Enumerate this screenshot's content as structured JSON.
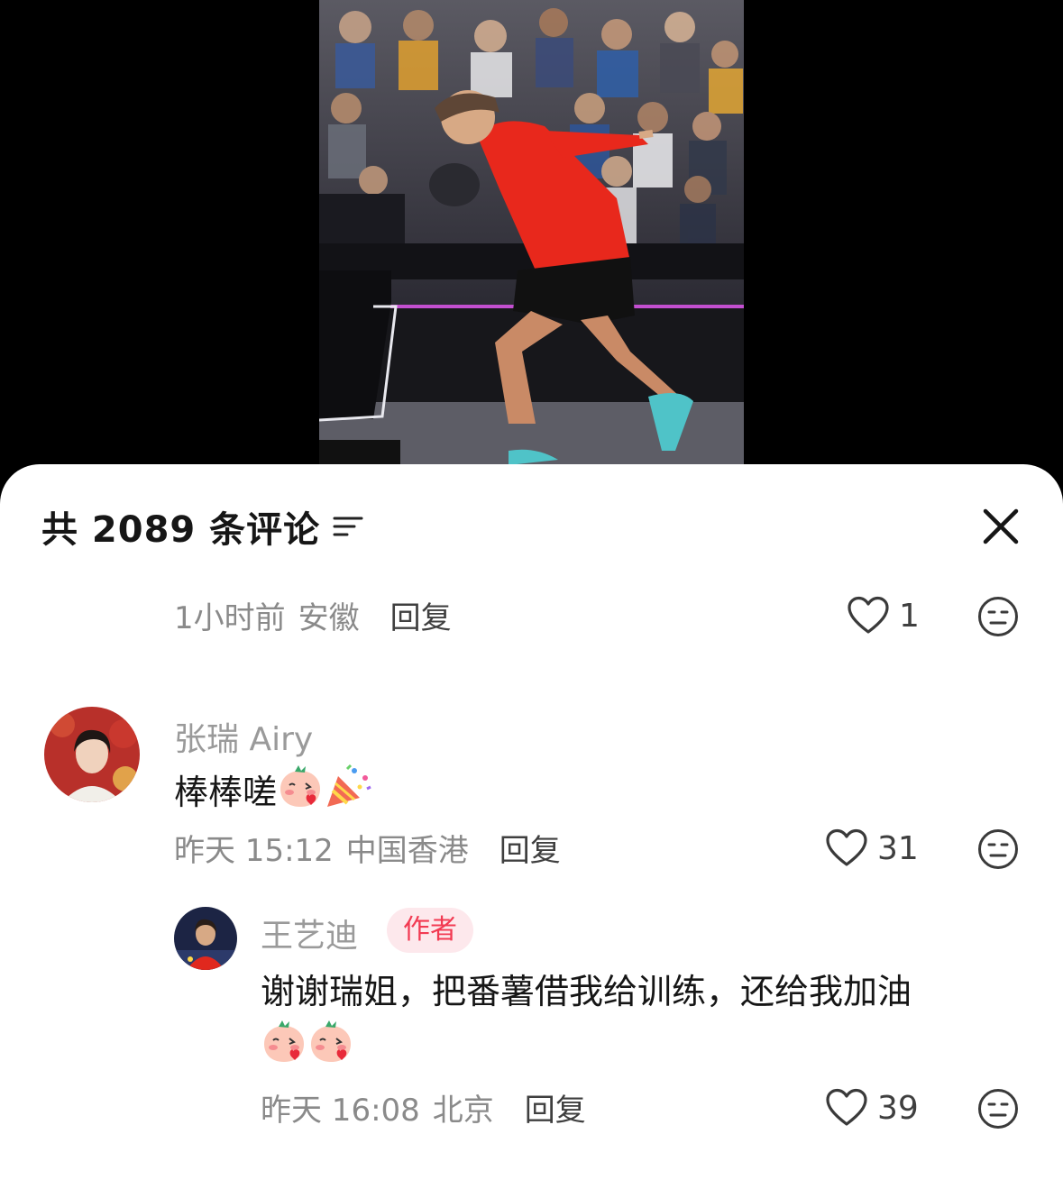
{
  "header": {
    "title": "共 2089 条评论"
  },
  "comments": [
    {
      "time": "1小时前",
      "location": "安徽",
      "reply_label": "回复",
      "likes": "1"
    },
    {
      "username": "张瑞 Airy",
      "text": "棒棒嗟",
      "emojis": [
        "blush-peach-emoji",
        "party-popper-emoji"
      ],
      "time": "昨天 15:12",
      "location": "中国香港",
      "reply_label": "回复",
      "likes": "31"
    },
    {
      "username": "王艺迪",
      "badge": "作者",
      "text": "谢谢瑞姐，把番薯借我给训练，还给我加油",
      "emojis": [
        "blush-peach-emoji",
        "blush-peach-emoji"
      ],
      "time": "昨天 16:08",
      "location": "北京",
      "reply_label": "回复",
      "likes": "39"
    }
  ],
  "colors": {
    "accent_badge_text": "#f23a52",
    "accent_badge_bg": "#fde8ec",
    "shirt_red": "#e8281c"
  }
}
